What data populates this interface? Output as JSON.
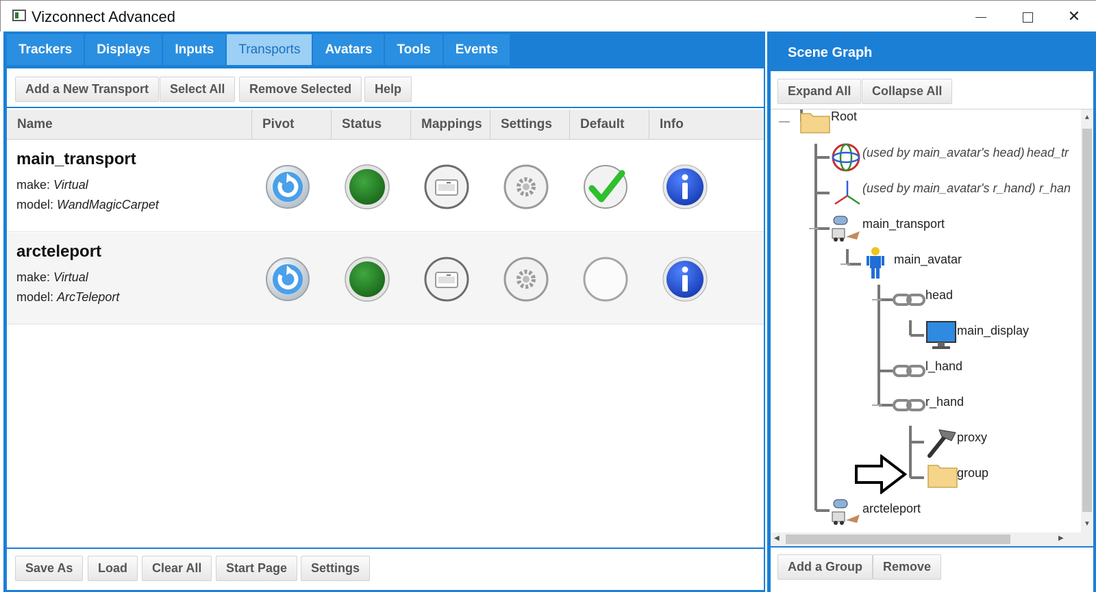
{
  "window": {
    "title": "Vizconnect Advanced",
    "minimize_icon": "minimize-icon",
    "maximize_icon": "maximize-icon",
    "close_icon": "close-icon"
  },
  "tabs": [
    "Trackers",
    "Displays",
    "Inputs",
    "Transports",
    "Avatars",
    "Tools",
    "Events"
  ],
  "active_tab": "Transports",
  "toolbar": {
    "add_new": "Add a New Transport",
    "select_all": "Select All",
    "remove_selected": "Remove Selected",
    "help": "Help"
  },
  "columns": [
    "Name",
    "Pivot",
    "Status",
    "Mappings",
    "Settings",
    "Default",
    "Info"
  ],
  "make_label": "make:",
  "model_label": "model:",
  "rows": [
    {
      "name": "main_transport",
      "make": "Virtual",
      "model": "WandMagicCarpet",
      "status": "active",
      "default": true
    },
    {
      "name": "arcteleport",
      "make": "Virtual",
      "model": "ArcTeleport",
      "status": "active",
      "default": false
    }
  ],
  "bottom": {
    "save_as": "Save As",
    "load": "Load",
    "clear_all": "Clear All",
    "start_page": "Start Page",
    "settings": "Settings"
  },
  "scene_graph": {
    "title": "Scene Graph",
    "expand_all": "Expand All",
    "collapse_all": "Collapse All",
    "add_group": "Add a Group",
    "remove": "Remove",
    "nodes": {
      "root": "Root",
      "head_tracker_note": "(used by main_avatar's head)",
      "head_tracker": "head_tr",
      "rhand_tracker_note": "(used by main_avatar's r_hand)",
      "rhand_tracker": "r_han",
      "main_transport": "main_transport",
      "main_avatar": "main_avatar",
      "head": "head",
      "main_display": "main_display",
      "l_hand": "l_hand",
      "r_hand": "r_hand",
      "proxy": "proxy",
      "group": "group",
      "arcteleport": "arcteleport"
    }
  },
  "colors": {
    "accent": "#1c7fd6",
    "tab_active_bg": "#9dd0f5",
    "status_green": "#2a8a2a",
    "info_blue": "#1f4fd6"
  }
}
